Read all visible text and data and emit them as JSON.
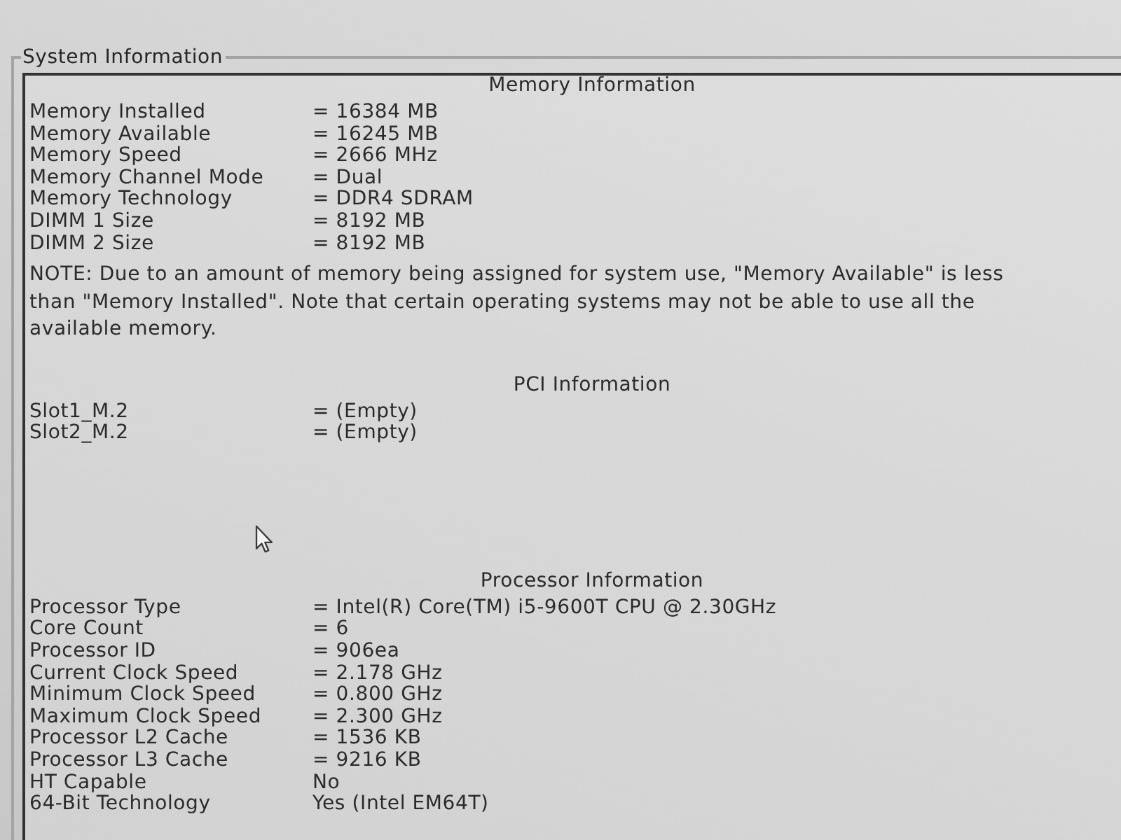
{
  "panel": {
    "title": "System Information",
    "sections": [
      {
        "heading": "Memory Information",
        "rows": [
          {
            "label": "Memory Installed",
            "value": "= 16384 MB"
          },
          {
            "label": "Memory Available",
            "value": "= 16245 MB"
          },
          {
            "label": "Memory Speed",
            "value": "= 2666 MHz"
          },
          {
            "label": "Memory Channel Mode",
            "value": "= Dual"
          },
          {
            "label": "Memory Technology",
            "value": "= DDR4 SDRAM"
          },
          {
            "label": "DIMM 1 Size",
            "value": "= 8192 MB"
          },
          {
            "label": "DIMM 2 Size",
            "value": "= 8192 MB"
          }
        ],
        "note": "NOTE: Due to an amount of memory being assigned for system use, \"Memory Available\" is less than \"Memory Installed\". Note that certain operating systems may not be able to use all the available memory."
      },
      {
        "heading": "PCI Information",
        "rows": [
          {
            "label": "Slot1_M.2",
            "value": "= (Empty)"
          },
          {
            "label": "Slot2_M.2",
            "value": "= (Empty)"
          }
        ]
      },
      {
        "heading": "Processor Information",
        "rows": [
          {
            "label": "Processor Type",
            "value": "= Intel(R) Core(TM) i5-9600T CPU @ 2.30GHz"
          },
          {
            "label": "Core Count",
            "value": "= 6"
          },
          {
            "label": "Processor ID",
            "value": "= 906ea"
          },
          {
            "label": "Current Clock Speed",
            "value": "= 2.178 GHz"
          },
          {
            "label": "Minimum Clock Speed",
            "value": "= 0.800 GHz"
          },
          {
            "label": "Maximum Clock Speed",
            "value": "= 2.300 GHz"
          },
          {
            "label": "Processor L2 Cache",
            "value": "= 1536 KB"
          },
          {
            "label": "Processor L3 Cache",
            "value": "= 9216 KB"
          },
          {
            "label": "HT Capable",
            "value": "No"
          },
          {
            "label": "64-Bit Technology",
            "value": "Yes (Intel EM64T)"
          }
        ]
      }
    ]
  }
}
